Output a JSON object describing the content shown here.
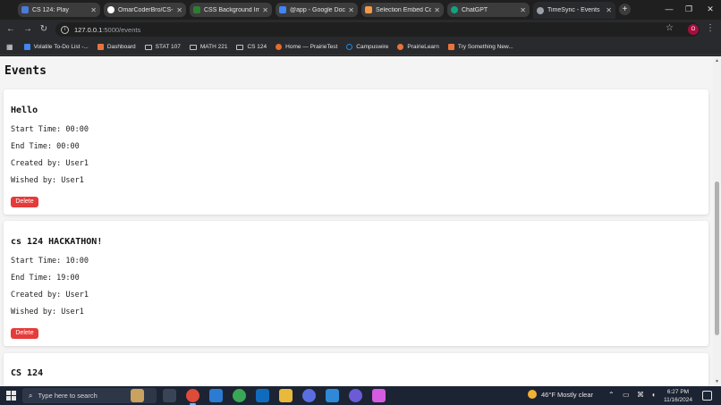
{
  "browser": {
    "tabs": [
      {
        "label": "CS 124: Play",
        "color": "#4a7bd8"
      },
      {
        "label": "OmarCoderBro/CS-1",
        "color": "#ffffff"
      },
      {
        "label": "CSS Background Ima",
        "color": "#2e7d32"
      },
      {
        "label": "@app - Google Docs",
        "color": "#4285f4"
      },
      {
        "label": "Selection Embed Co",
        "color": "#f2994a"
      },
      {
        "label": "ChatGPT",
        "color": "#10a37f"
      },
      {
        "label": "TimeSync - Events",
        "color": "#9aa0a6"
      }
    ],
    "address": {
      "host": "127.0.0.1",
      "rest": ":5000/events"
    },
    "profile_initial": "O",
    "bookmarks": [
      {
        "label": "Volatile To-Do List -...",
        "icon": "doc-icon",
        "color": "#4285f4"
      },
      {
        "label": "Dashboard",
        "icon": "illinois-icon",
        "color": "#e8743b"
      },
      {
        "label": "STAT 107",
        "icon": "folder-icon",
        "color": ""
      },
      {
        "label": "MATH 221",
        "icon": "folder-icon",
        "color": ""
      },
      {
        "label": "CS 124",
        "icon": "folder-icon",
        "color": ""
      },
      {
        "label": "Home — PrairieTest",
        "icon": "prairietest-icon",
        "color": "#e86a2a"
      },
      {
        "label": "Campuswire",
        "icon": "campuswire-icon",
        "color": "#1e88e5"
      },
      {
        "label": "PrairieLearn",
        "icon": "prairielearn-icon",
        "color": "#e8743b"
      },
      {
        "label": "Try Something New...",
        "icon": "illinois-icon",
        "color": "#e8743b"
      }
    ]
  },
  "page": {
    "heading": "Events",
    "events": [
      {
        "title": "Hello",
        "start": "Start Time: 00:00",
        "end": "End Time: 00:00",
        "created": "Created by: User1",
        "wished": "Wished by: User1",
        "delete_label": "Delete"
      },
      {
        "title": "cs 124 HACKATHON!",
        "start": "Start Time: 10:00",
        "end": "End Time: 19:00",
        "created": "Created by: User1",
        "wished": "Wished by: User1",
        "delete_label": "Delete"
      },
      {
        "title": "CS 124"
      }
    ]
  },
  "taskbar": {
    "search_placeholder": "Type here to search",
    "weather": "46°F  Mostly clear",
    "time": "6:27 PM",
    "date": "11/16/2024"
  },
  "colors": {
    "accent_delete": "#e63b3b",
    "content_bg": "#f4f4f4",
    "browser_bg": "#1f1f1f",
    "taskbar_bg": "#1c2433"
  }
}
